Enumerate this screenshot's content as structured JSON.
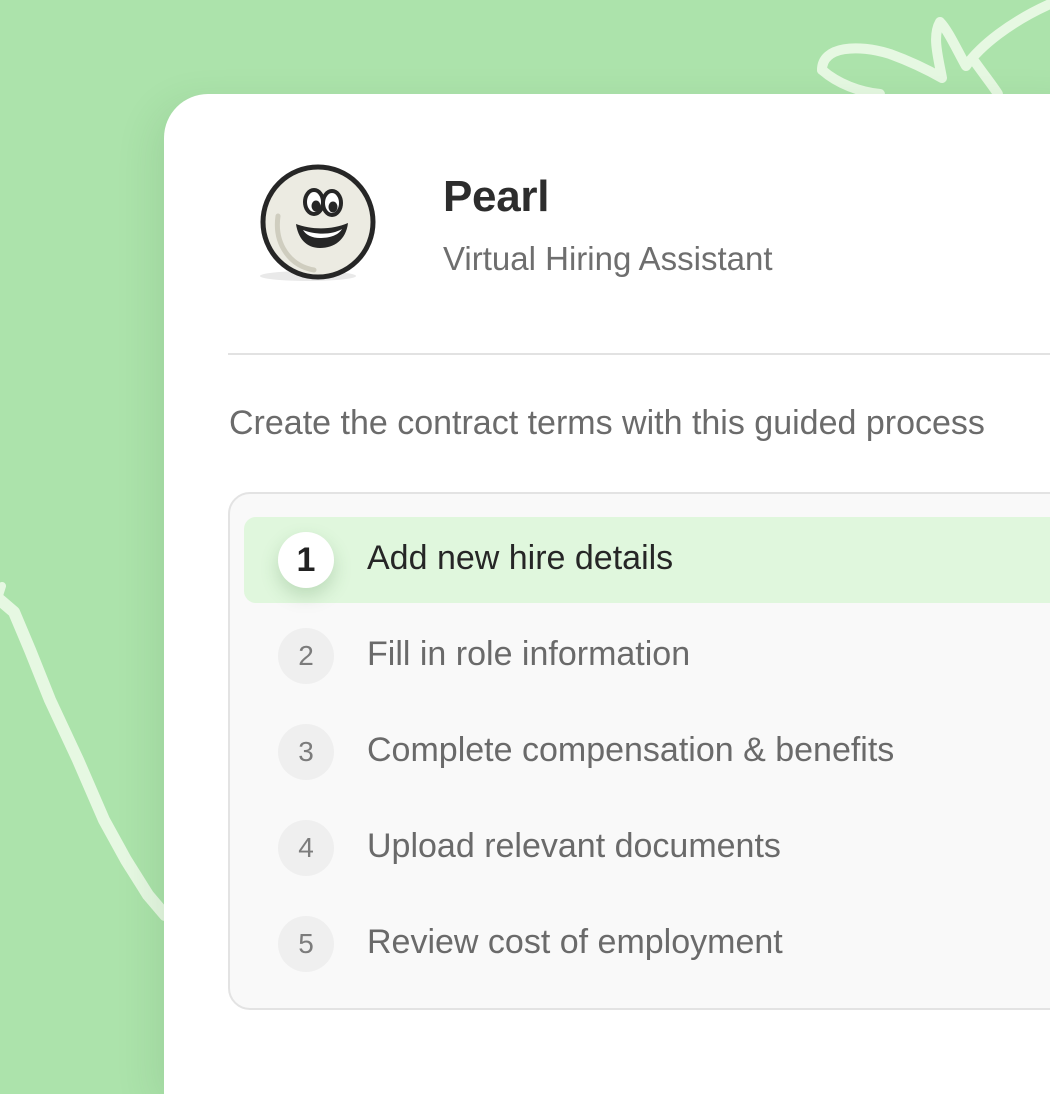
{
  "assistant": {
    "name": "Pearl",
    "role": "Virtual Hiring Assistant"
  },
  "intro_text": "Create the contract terms with this guided process",
  "steps": [
    {
      "number": "1",
      "label": "Add new hire details",
      "active": true
    },
    {
      "number": "2",
      "label": "Fill in role information",
      "active": false
    },
    {
      "number": "3",
      "label": "Complete compensation & benefits",
      "active": false
    },
    {
      "number": "4",
      "label": "Upload relevant documents",
      "active": false
    },
    {
      "number": "5",
      "label": "Review cost of employment",
      "active": false
    }
  ],
  "colors": {
    "background": "#ace3ab",
    "card": "#ffffff",
    "active_step": "#e0f7dd",
    "doodle": "#e6f8e2"
  }
}
